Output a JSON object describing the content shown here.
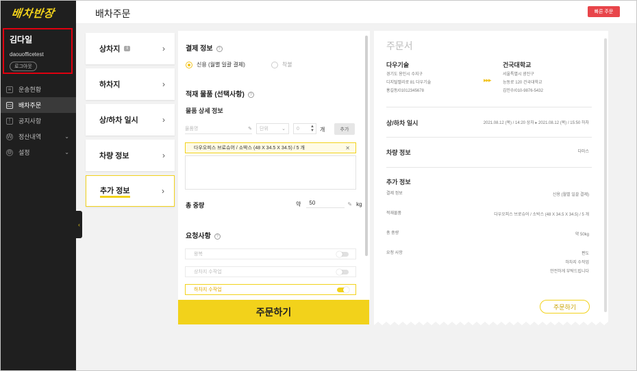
{
  "sidebar": {
    "logo": "배차반장",
    "profile": {
      "name": "김다일",
      "id": "daouofficetest",
      "logout": "로그아웃"
    },
    "items": [
      {
        "label": "운송현황",
        "icon": "document-icon"
      },
      {
        "label": "배차주문",
        "icon": "truck-icon"
      },
      {
        "label": "공지사항",
        "icon": "notice-icon"
      },
      {
        "label": "정산내역",
        "icon": "won-icon"
      },
      {
        "label": "설정",
        "icon": "gear-icon"
      }
    ]
  },
  "header": {
    "title": "배차주문",
    "quick_order": "빠른 주문"
  },
  "steps": [
    {
      "label": "상차지"
    },
    {
      "label": "하차지"
    },
    {
      "label": "상/하차 일시"
    },
    {
      "label": "차량 정보"
    },
    {
      "label": "추가 정보"
    }
  ],
  "form": {
    "payment_title": "결제 정보",
    "payment_credit": "신용 (월별 일괄 결제)",
    "payment_card": "착불",
    "cargo_title": "적재 물품 (선택사항)",
    "cargo_detail": "물품 상세 정보",
    "item_placeholder": "물품명",
    "unit_placeholder": "단위",
    "qty_value": "0",
    "qty_unit": "개",
    "add_label": "추가",
    "tag_text": "다우오피스 브로슈어 / 소박스 (48 X 34.5 X 34.5) / 5 개",
    "total_weight_label": "총 중량",
    "weight_prefix": "약",
    "weight_value": "50",
    "weight_unit": "kg",
    "request_title": "요청사항",
    "requests": [
      {
        "label": "왕복",
        "on": false
      },
      {
        "label": "상차지 수작업",
        "on": false
      },
      {
        "label": "하차지 수작업",
        "on": true
      }
    ],
    "order_button": "주문하기"
  },
  "receipt": {
    "title": "주문서",
    "from_name": "다우기술",
    "from_addr": [
      "경기도 용인시 수지구",
      "디지털밸리로 81 다우기술",
      "홍길동/01012345678"
    ],
    "to_name": "건국대학교",
    "to_addr": [
      "서울특별시 광진구",
      "능동로 120 건국대학교",
      "김민수/010-9876-5432"
    ],
    "schedule_label": "상/하차 일시",
    "schedule_value": "2021.08.12 (목) / 14:20 상차  ▸  2021.08.12 (목) / 15:50 하차",
    "vehicle_label": "차량 정보",
    "vehicle_value": "다마스",
    "extra_label": "추가 정보",
    "payment_label": "결제 정보",
    "payment_value": "신용 (월별 일괄 결제)",
    "cargo_label": "적재물품",
    "cargo_value": "다우오피스 브로슈어 / 소박스 (48 X 34.5 X 34.5) / 5 개",
    "weight_label": "총 중량",
    "weight_value": "약 50kg",
    "request_label": "요청 사항",
    "request_values": [
      "편도",
      "하차지 수작업",
      "안전하게 부탁드립니다"
    ],
    "order_button": "주문하기"
  }
}
